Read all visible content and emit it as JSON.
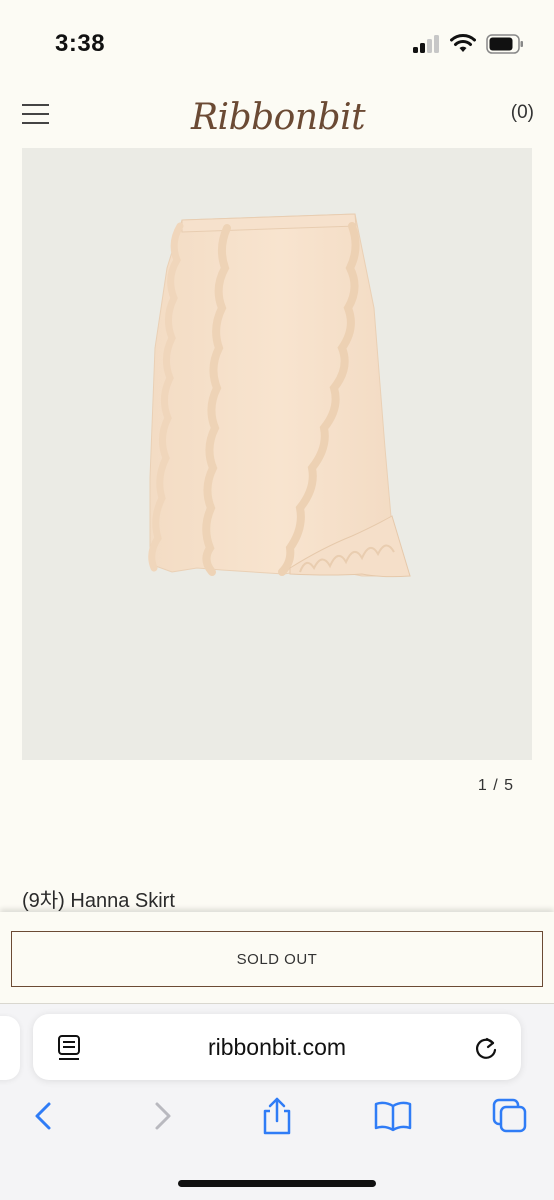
{
  "status_bar": {
    "time": "3:38"
  },
  "header": {
    "logo": "Ribbonbit",
    "cart_label": "(0)"
  },
  "gallery": {
    "pager": "1 / 5"
  },
  "product": {
    "title": "(9차) Hanna Skirt"
  },
  "buy_bar": {
    "sold_out_label": "SOLD OUT"
  },
  "browser": {
    "url": "ribbonbit.com"
  },
  "colors": {
    "page_background": "#fcfbf4",
    "brand_brown": "#6b4a34",
    "image_background": "#ebebe5",
    "ios_blue": "#2f7cf6"
  },
  "icons": {
    "menu": "hamburger-icon",
    "reader": "reader-mode-icon",
    "reload": "reload-icon",
    "back": "chevron-left-icon",
    "forward": "chevron-right-icon",
    "share": "share-icon",
    "bookmarks": "book-icon",
    "tabs": "tabs-icon"
  }
}
